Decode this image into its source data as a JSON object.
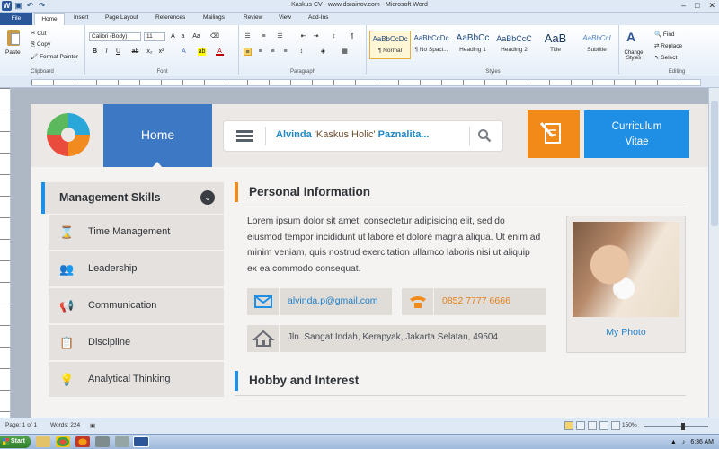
{
  "window": {
    "title": "Kaskus CV - www.dsrainov.com - Microsoft Word",
    "controls": [
      "–",
      "□",
      "✕"
    ]
  },
  "ribbon_tabs": [
    "File",
    "Home",
    "Insert",
    "Page Layout",
    "References",
    "Mailings",
    "Review",
    "View",
    "Add-Ins"
  ],
  "ribbon": {
    "clipboard": {
      "paste": "Paste",
      "cut": "Cut",
      "copy": "Copy",
      "format_painter": "Format Painter",
      "label": "Clipboard"
    },
    "font": {
      "name": "Calibri (Body)",
      "size": "11",
      "label": "Font"
    },
    "paragraph": {
      "label": "Paragraph"
    },
    "styles": {
      "label": "Styles",
      "items": [
        {
          "sample": "AaBbCcDc",
          "name": "¶ Normal"
        },
        {
          "sample": "AaBbCcDc",
          "name": "¶ No Spaci..."
        },
        {
          "sample": "AaBbCc",
          "name": "Heading 1"
        },
        {
          "sample": "AaBbCcC",
          "name": "Heading 2"
        },
        {
          "sample": "AaB",
          "name": "Title"
        },
        {
          "sample": "AaBbCcI",
          "name": "Subtitle"
        }
      ],
      "change_styles": "Change Styles"
    },
    "editing": {
      "find": "Find",
      "replace": "Replace",
      "select": "Select",
      "label": "Editing"
    }
  },
  "document": {
    "header": {
      "nav_home": "Home",
      "search_name": "Alvinda",
      "search_nick": " 'Kaskus Holic' ",
      "search_last": "Paznalita...",
      "cv_line1": "Curriculum",
      "cv_line2": "Vitae"
    },
    "sidebar": {
      "heading": "Management Skills",
      "items": [
        {
          "label": "Time Management",
          "icon": "⌛"
        },
        {
          "label": "Leadership",
          "icon": "👥"
        },
        {
          "label": "Communication",
          "icon": "📢"
        },
        {
          "label": "Discipline",
          "icon": "📋"
        },
        {
          "label": "Analytical Thinking",
          "icon": "💡"
        }
      ]
    },
    "personal": {
      "title": "Personal Information",
      "bio": "Lorem ipsum dolor sit amet, consectetur adipisicing elit, sed do eiusmod tempor incididunt ut labore et dolore magna aliqua. Ut enim ad minim veniam, quis nostrud exercitation ullamco laboris nisi ut aliquip ex ea commodo consequat.",
      "email": "alvinda.p@gmail.com",
      "phone": "0852 7777 6666",
      "address": "Jln. Sangat Indah, Kerapyak, Jakarta Selatan, 49504",
      "photo_caption": "My Photo"
    },
    "hobby": {
      "title": "Hobby and Interest"
    }
  },
  "statusbar": {
    "page": "Page: 1 of 1",
    "words": "Words: 224",
    "zoom": "150%"
  },
  "taskbar": {
    "start": "Start",
    "time": "6:36 AM"
  },
  "colors": {
    "accent_blue": "#1f8fe6",
    "accent_orange": "#f28a1a",
    "word_blue": "#2b579a"
  }
}
